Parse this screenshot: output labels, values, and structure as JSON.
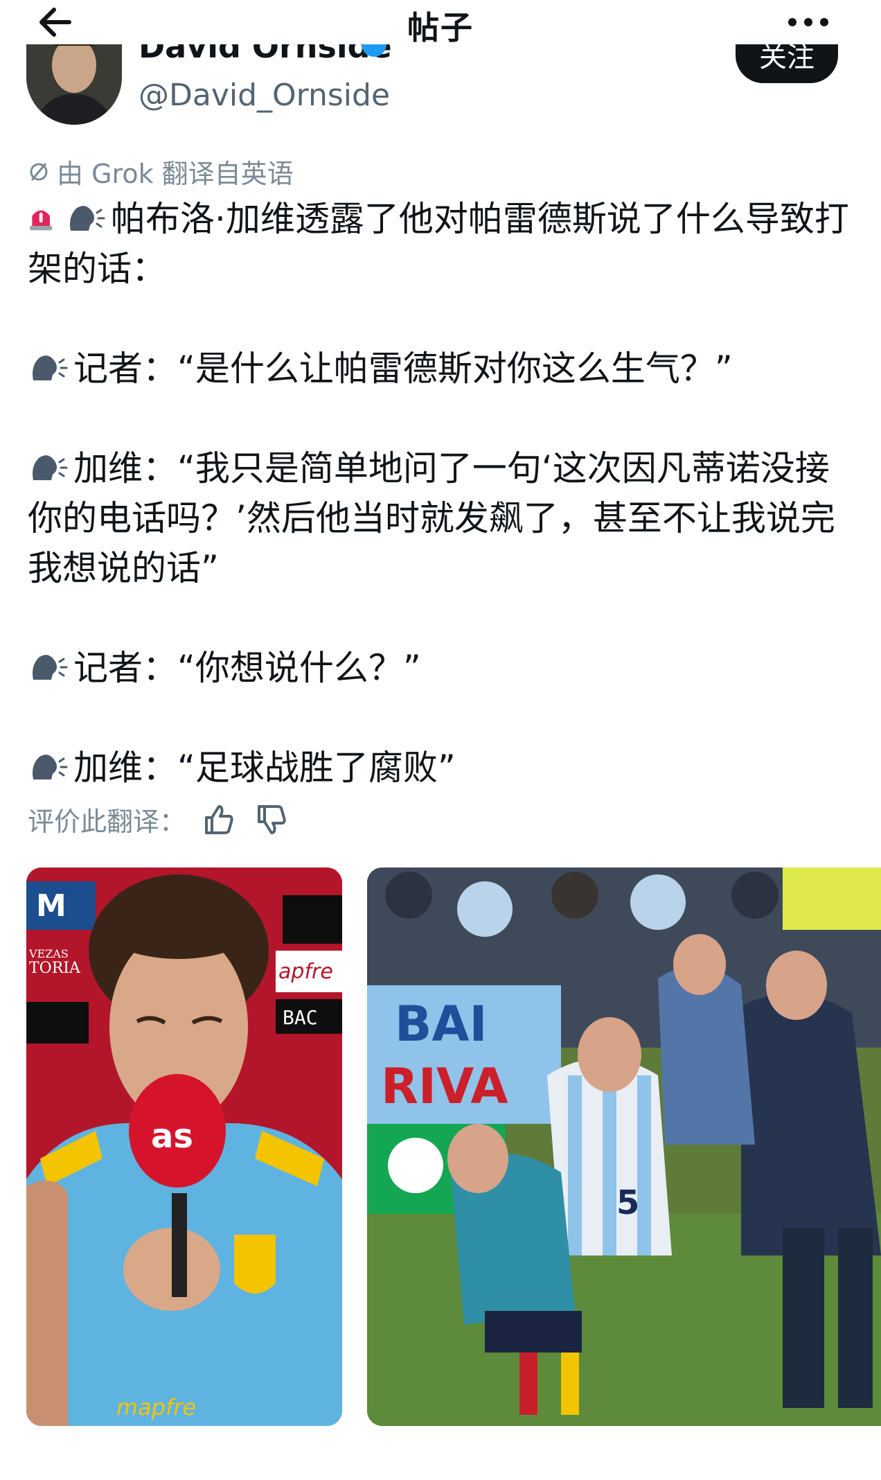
{
  "header": {
    "title": "帖子",
    "back_icon": "arrow-left-icon",
    "more_icon": "more-horizontal-icon"
  },
  "author": {
    "name": "David Ornside",
    "handle": "@David_Ornside",
    "follow_label": "关注",
    "verified_color": "#1d9bf0"
  },
  "translation_note": "由 Grok 翻译自英语",
  "post": {
    "line1": "帕布洛·加维透露了他对帕雷德斯说了什么导致打架的话：",
    "line2": "记者：“是什么让帕雷德斯对你这么生气？”",
    "line3": "加维：“我只是简单地问了一句‘这次因凡蒂诺没接你的电话吗？’然后他当时就发飙了，甚至不让我说完我想说的话”",
    "line4": "记者：“你想说什么？”",
    "line5": "加维：“足球战胜了腐败”"
  },
  "rating": {
    "label": "评价此翻译："
  },
  "media": {
    "image1_text": {
      "mic": "as",
      "board1": "VEZAS",
      "board2": "TORIA",
      "board3": "apfre",
      "board4": "BAC",
      "shirt": "mapfre"
    },
    "image2_text": {
      "banner1": "BAI",
      "banner2": "RIVA",
      "number": "5"
    }
  },
  "colors": {
    "text": "#0f1419",
    "muted": "#536471",
    "accent": "#1d9bf0",
    "alert_red": "#e0245e"
  }
}
